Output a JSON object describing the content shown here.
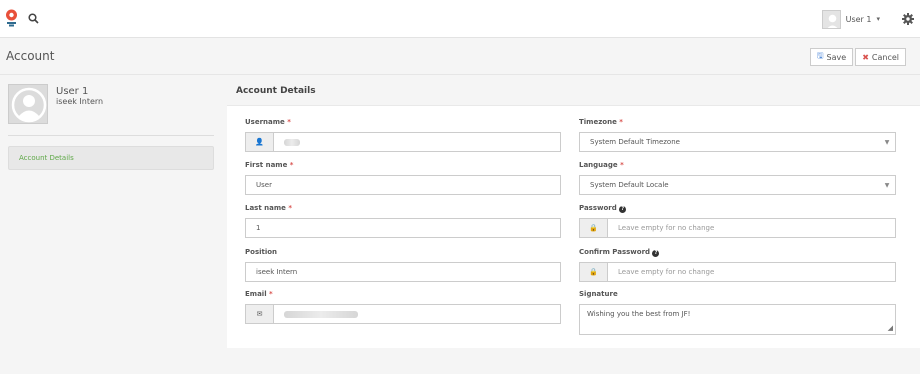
{
  "nav": {
    "user_label": "User 1",
    "icons": [
      "logo-icon",
      "search-icon",
      "chevron-down-icon",
      "gear-icon"
    ]
  },
  "header": {
    "title": "Account",
    "save_label": "Save",
    "cancel_label": "Cancel"
  },
  "sidebar": {
    "name": "User 1",
    "position": "iseek Intern",
    "items": [
      {
        "label": "Account Details",
        "active": true
      }
    ]
  },
  "section": {
    "title": "Account Details"
  },
  "form": {
    "username": {
      "label": "Username",
      "required": "*",
      "value_obscured": true
    },
    "first_name": {
      "label": "First name",
      "required": "*",
      "value": "User"
    },
    "last_name": {
      "label": "Last name",
      "required": "*",
      "value": "1"
    },
    "position": {
      "label": "Position",
      "value": "iseek Intern"
    },
    "email": {
      "label": "Email",
      "required": "*",
      "value_obscured": true
    },
    "timezone": {
      "label": "Timezone",
      "required": "*",
      "value": "System Default Timezone"
    },
    "language": {
      "label": "Language",
      "required": "*",
      "value": "System Default Locale"
    },
    "password": {
      "label": "Password",
      "placeholder": "Leave empty for no change"
    },
    "confirm_password": {
      "label": "Confirm Password",
      "placeholder": "Leave empty for no change"
    },
    "signature": {
      "label": "Signature",
      "value": "Wishing you the best from JF!"
    }
  },
  "colors": {
    "accent_green": "#5fa848",
    "required_red": "#d9534f",
    "logo_red": "#e8503a",
    "save_blue": "#3a7bd5"
  }
}
